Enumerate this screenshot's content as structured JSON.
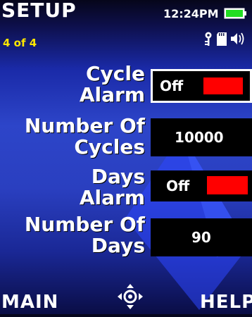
{
  "header": {
    "title": "SETUP",
    "page": "4 of 4",
    "time": "12:24PM"
  },
  "rows": [
    {
      "label_line1": "Cycle",
      "label_line2": "Alarm",
      "value": "Off",
      "indicator_color": "#ff0000"
    },
    {
      "label_line1": "Number Of",
      "label_line2": "Cycles",
      "value": "10000"
    },
    {
      "label_line1": "Days",
      "label_line2": "Alarm",
      "value": "Off",
      "indicator_color": "#ff0000"
    },
    {
      "label_line1": "Number Of",
      "label_line2": "Days",
      "value": "90"
    }
  ],
  "softkeys": {
    "left": "MAIN",
    "right": "HELP"
  },
  "icons": [
    "key-icon",
    "sd-card-icon",
    "speaker-icon",
    "battery-icon",
    "navigation-icon"
  ],
  "colors": {
    "accent_yellow": "#ffe600",
    "battery_green": "#22dd22",
    "indicator_red": "#ff0000"
  }
}
